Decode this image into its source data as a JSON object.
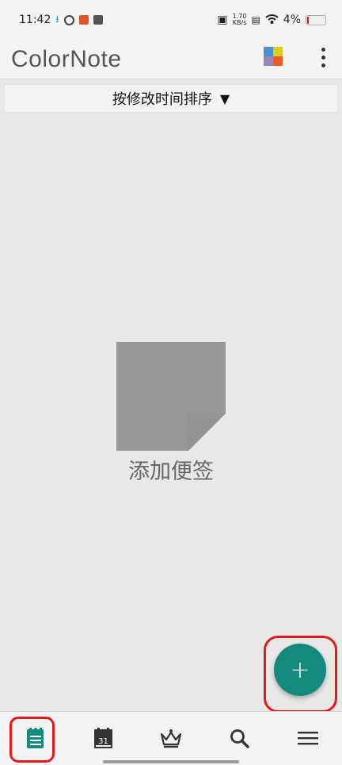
{
  "status_bar": {
    "time": "11:42",
    "network_speed": "1.70\nKB/s",
    "battery": "4%"
  },
  "app": {
    "name": "ColorNote"
  },
  "sort": {
    "label": "按修改时间排序",
    "arrow": "▼"
  },
  "empty_state": {
    "label": "添加便签"
  },
  "fab": {
    "label": "+"
  },
  "bottom_nav": [
    {
      "name": "notes",
      "label": "",
      "selected": true
    },
    {
      "name": "calendar",
      "label": "31",
      "selected": false
    },
    {
      "name": "premium",
      "label": "",
      "selected": false
    },
    {
      "name": "search",
      "label": "",
      "selected": false
    },
    {
      "name": "menu",
      "label": "",
      "selected": false
    }
  ],
  "colors": {
    "accent": "#138a7d",
    "highlight": "#e21a1a",
    "background": "#e8e8e8"
  }
}
